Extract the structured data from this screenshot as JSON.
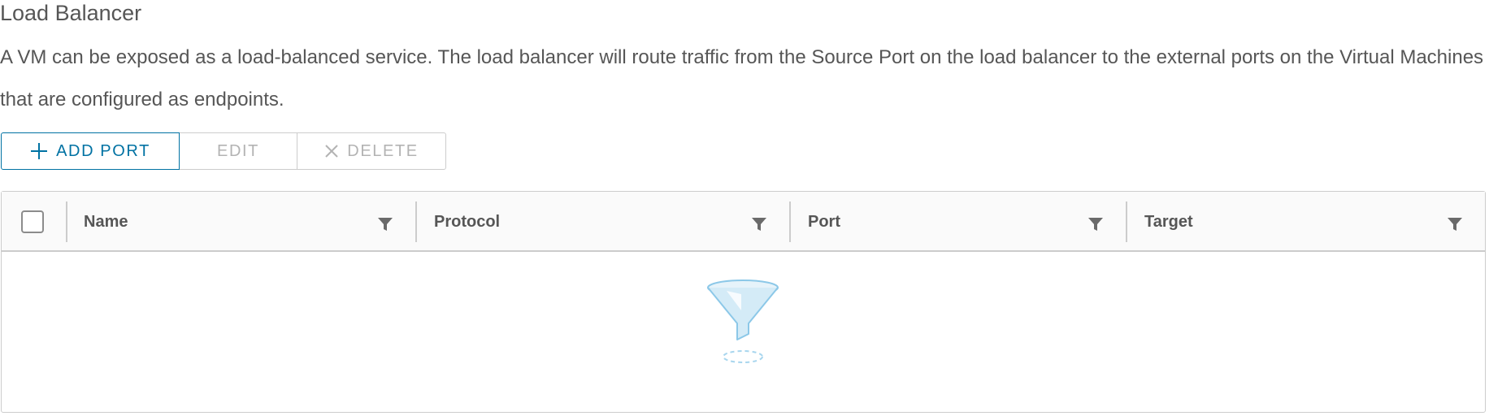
{
  "section": {
    "title": "Load Balancer",
    "description": "A VM can be exposed as a load-balanced service. The load balancer will route traffic from the Source Port on the load balancer to the external ports on the Virtual Machines that are configured as endpoints."
  },
  "toolbar": {
    "add_port_label": "ADD PORT",
    "add_port_icon": "plus-icon",
    "edit_label": "EDIT",
    "delete_label": "DELETE",
    "delete_icon": "close-icon"
  },
  "grid": {
    "columns": [
      {
        "label": "Name",
        "icon": "filter-icon"
      },
      {
        "label": "Protocol",
        "icon": "filter-icon"
      },
      {
        "label": "Port",
        "icon": "filter-icon"
      },
      {
        "label": "Target",
        "icon": "filter-icon"
      }
    ],
    "rows": [],
    "empty_state_icon": "empty-funnel-icon"
  },
  "colors": {
    "primary": "#0072a3",
    "text": "#565656",
    "disabled": "#b3b3b3",
    "border": "#cccccc",
    "illustration": "#8cc8e8"
  }
}
